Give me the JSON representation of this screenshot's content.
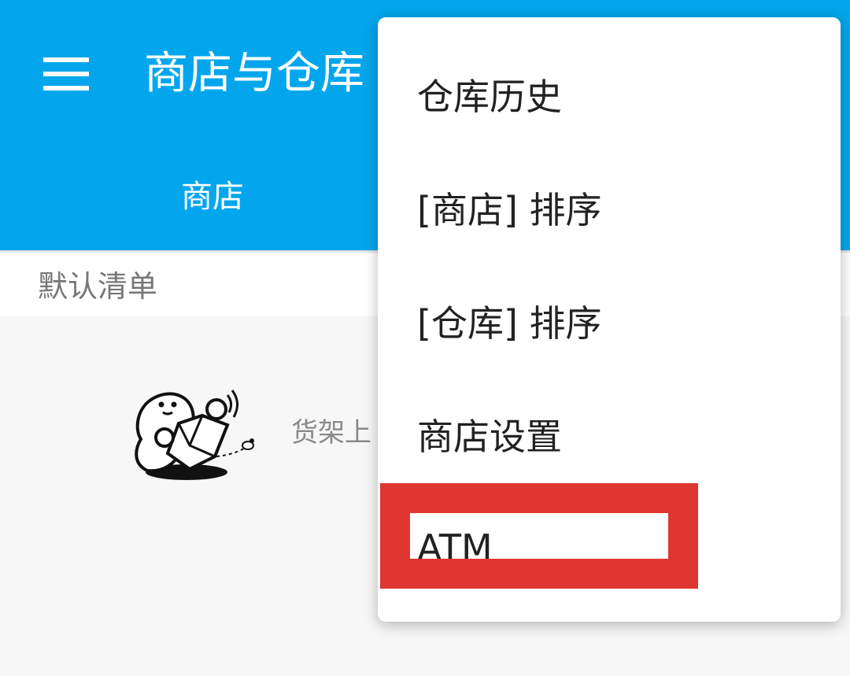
{
  "appbar": {
    "title": "商店与仓库",
    "background": "#03a6ec",
    "menu_icon": "hamburger-menu-icon"
  },
  "tabs": [
    {
      "label": "商店"
    }
  ],
  "list": {
    "name": "默认清单"
  },
  "empty_state": {
    "illustration": "ghost-with-box-illustration",
    "text": "货架上"
  },
  "overflow_menu": {
    "items": [
      {
        "label": "仓库历史"
      },
      {
        "label": "[商店] 排序"
      },
      {
        "label": "[仓库] 排序"
      },
      {
        "label": "商店设置"
      },
      {
        "label": "ATM"
      }
    ]
  },
  "highlight_color": "#e03631"
}
